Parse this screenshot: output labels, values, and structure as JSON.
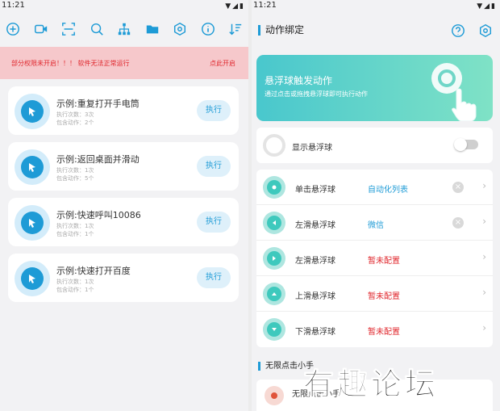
{
  "left": {
    "status_time": "11:21",
    "toolbar_icons": [
      "add-icon",
      "video-icon",
      "scan-icon",
      "search-icon",
      "tree-icon",
      "folder-icon",
      "settings-hex-icon",
      "info-icon",
      "sort-icon"
    ],
    "warning": {
      "message": "部分权限未开启！！！ 软件无法正常运行",
      "action": "点此开启"
    },
    "tasks": [
      {
        "title": "示例:重复打开手电筒",
        "runs": "执行次数：3次",
        "actions": "包含动作：2个",
        "button": "执行"
      },
      {
        "title": "示例:返回桌面并滑动",
        "runs": "执行次数：1次",
        "actions": "包含动作：5个",
        "button": "执行"
      },
      {
        "title": "示例:快速呼叫10086",
        "runs": "执行次数：1次",
        "actions": "包含动作：1个",
        "button": "执行"
      },
      {
        "title": "示例:快速打开百度",
        "runs": "执行次数：1次",
        "actions": "包含动作：1个",
        "button": "执行"
      }
    ]
  },
  "right": {
    "status_time": "11:21",
    "title": "动作绑定",
    "banner": {
      "title": "悬浮球触发动作",
      "subtitle": "通过点击或拖拽悬浮球即可执行动作"
    },
    "show_ball": {
      "label": "显示悬浮球",
      "enabled": false
    },
    "gestures": [
      {
        "label": "单击悬浮球",
        "value": "自动化列表",
        "configured": true
      },
      {
        "label": "左滑悬浮球",
        "value": "微信",
        "configured": true
      },
      {
        "label": "左滑悬浮球",
        "value": "暂未配置",
        "configured": false
      },
      {
        "label": "上滑悬浮球",
        "value": "暂未配置",
        "configured": false
      },
      {
        "label": "下滑悬浮球",
        "value": "暂未配置",
        "configured": false
      }
    ],
    "section2_title": "无限点击小手",
    "section2_row": "无限点击小手"
  },
  "watermark": "有趣论坛",
  "colors": {
    "accent": "#1e9bd6",
    "danger": "#e0282e",
    "teal": "#3ec9bd"
  }
}
